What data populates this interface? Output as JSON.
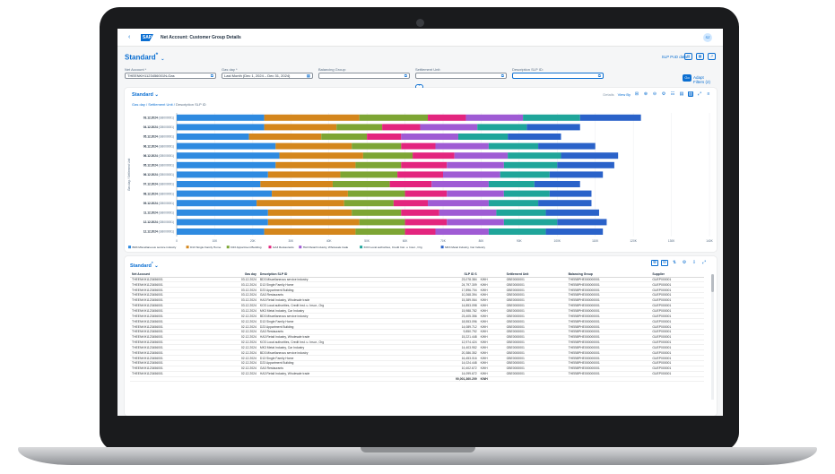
{
  "app": {
    "back_glyph": "‹",
    "logo_text": "SAP",
    "title": "Net Account: Customer Group Details",
    "avatar": "SZ"
  },
  "variant": {
    "label": "Standard",
    "marker": "*"
  },
  "header_actions": {
    "slp_button": "SLP PoD data"
  },
  "filters": [
    {
      "label": "Net Account *",
      "value": "THEENKH1123456001N-Gas"
    },
    {
      "label": "Gas day *",
      "value": "Last Month (Dec 1, 2024 – Dec 31, 2024)"
    },
    {
      "label": "Balancing Group:",
      "value": ""
    },
    {
      "label": "Settlement Unit:",
      "value": ""
    },
    {
      "label": "Description SLP ID:",
      "value": ""
    }
  ],
  "filter_actions": {
    "go": "Go",
    "adapt": "Adapt Filters (2)"
  },
  "chart_card": {
    "title": "Standard",
    "breadcrumb": [
      "Gas day",
      "Settlement Unit",
      "Description SLP ID"
    ],
    "view_label": "Details",
    "view_by": "View By"
  },
  "chart_data": {
    "type": "bar",
    "orientation": "horizontal",
    "stacked": true,
    "ylabel": "Gas day / Settlement Unit",
    "categories": [
      "03.12.2024 (GB000001)",
      "04.12.2024 (GB000001)",
      "05.12.2024 (GB000001)",
      "06.12.2024 (GB000001)",
      "06.12.2024 (GB000001)",
      "05.12.2024 (GB000001)",
      "06.12.2024 (GB000001)",
      "07.12.2024 (GB000001)",
      "08.12.2024 (GB000001)",
      "09.12.2024 (GB000001)",
      "11.12.2024 (GB000001)",
      "12.12.2024 (GB000001)",
      "12.12.2024 (GB000001)"
    ],
    "x_ticks": [
      "0",
      "10K",
      "20K",
      "30K",
      "40K",
      "50K",
      "60K",
      "70K",
      "80K",
      "90K",
      "100K",
      "110K",
      "120K",
      "130K",
      "140K"
    ],
    "xlim": [
      0,
      140000
    ],
    "series": [
      {
        "name": "BD3 Miscellaneous service industry",
        "color": "#2e8ae0",
        "values": [
          23000,
          23000,
          19000,
          26000,
          27000,
          26000,
          24000,
          22000,
          25000,
          21000,
          24000,
          24000,
          23000
        ]
      },
      {
        "name": "D13 Single Family Home",
        "color": "#d4861c",
        "values": [
          25000,
          19000,
          19000,
          20000,
          22000,
          21000,
          19000,
          19000,
          20000,
          23000,
          22000,
          24000,
          24000
        ]
      },
      {
        "name": "D23 Appartment Building",
        "color": "#7da534",
        "values": [
          18000,
          12000,
          12000,
          13000,
          13000,
          12000,
          15000,
          15000,
          15000,
          13000,
          13000,
          12000,
          13000
        ]
      },
      {
        "name": "GA3 Restaurants",
        "color": "#e3257e",
        "values": [
          10000,
          10000,
          9000,
          9000,
          11000,
          12000,
          12000,
          11000,
          11000,
          9000,
          10000,
          11000,
          8000
        ]
      },
      {
        "name": "HA3 Retail Industry, Wholesale trade",
        "color": "#9f5bd4",
        "values": [
          15000,
          15000,
          15000,
          14000,
          14000,
          15000,
          15000,
          15000,
          15000,
          16000,
          15000,
          15000,
          14000
        ]
      },
      {
        "name": "KO3 Local authorities, Credit Inst. u. Insur., Org",
        "color": "#1fa59a",
        "values": [
          15000,
          13000,
          13000,
          13000,
          14000,
          14000,
          13000,
          12000,
          12000,
          13000,
          13000,
          14000,
          15000
        ]
      },
      {
        "name": "MK3 Metal Industry, Car Industry",
        "color": "#2a62c9",
        "values": [
          16000,
          14000,
          14000,
          15000,
          15000,
          15000,
          14000,
          12000,
          11000,
          14000,
          14000,
          13000,
          15000
        ]
      }
    ]
  },
  "table_card": {
    "title": "Standard",
    "marker": "*",
    "columns": [
      "Net Account",
      "Gas day",
      "Description SLP ID",
      "SLP ID S",
      "",
      "Settlement Unit",
      "Balancing Group",
      "Supplier"
    ],
    "rows": [
      [
        "THEENKH1123456001",
        "03.12.2024",
        "BD3 Miscellaneous service industry",
        "23,078.384",
        "KWH",
        "GBE0000001",
        "THEBBPHE000000001",
        "GUEP000001"
      ],
      [
        "THEENKH1123456001",
        "03.12.2024",
        "D13 Single Family Home",
        "24,797.309",
        "KWH",
        "GBE0000001",
        "THEBBPHE000000001",
        "GUEP000001"
      ],
      [
        "THEENKH1123456001",
        "03.12.2024",
        "D23 Appartment Building",
        "17,896.704",
        "KWH",
        "GBE0000001",
        "THEBBPHE000000001",
        "GUEP000001"
      ],
      [
        "THEENKH1123456001",
        "03.12.2024",
        "GA3 Restaurants",
        "10,268.394",
        "KWH",
        "GBE0000001",
        "THEBBPHE000000001",
        "GUEP000001"
      ],
      [
        "THEENKH1123456001",
        "03.12.2024",
        "HA3 Retail Industry, Wholesale trade",
        "15,389.064",
        "KWH",
        "GBE0000001",
        "THEBBPHE000000001",
        "GUEP000001"
      ],
      [
        "THEENKH1123456001",
        "03.12.2024",
        "KO3 Local authorities, Credit Inst. u. Insur., Org",
        "14,853.098",
        "KWH",
        "GBE0000001",
        "THEBBPHE000000001",
        "GUEP000001"
      ],
      [
        "THEENKH1123456001",
        "03.12.2024",
        "MK3 Metal Industry, Car Industry",
        "15,988.782",
        "KWH",
        "GBE0000001",
        "THEBBPHE000000001",
        "GUEP000001"
      ],
      [
        "THEENKH1123456001",
        "02.12.2024",
        "BD3 Miscellaneous service industry",
        "23,405.356",
        "KWH",
        "GBE0000001",
        "THEBBPHE000000001",
        "GUEP000001"
      ],
      [
        "THEENKH1123456001",
        "02.12.2024",
        "D13 Single Family Home",
        "18,553.096",
        "KWH",
        "GBE0000001",
        "THEBBPHE000000001",
        "GUEP000001"
      ],
      [
        "THEENKH1123456001",
        "02.12.2024",
        "D23 Appartment Building",
        "14,089.712",
        "KWH",
        "GBE0000001",
        "THEBBPHE000000001",
        "GUEP000001"
      ],
      [
        "THEENKH1123456001",
        "02.12.2024",
        "GA3 Restaurants",
        "9,850.792",
        "KWH",
        "GBE0000001",
        "THEBBPHE000000001",
        "GUEP000001"
      ],
      [
        "THEENKH1123456001",
        "02.12.2024",
        "HA3 Retail Industry, Wholesale trade",
        "15,221.448",
        "KWH",
        "GBE0000001",
        "THEBBPHE000000001",
        "GUEP000001"
      ],
      [
        "THEENKH1123456001",
        "02.12.2024",
        "KO3 Local authorities, Credit Inst. u. Insur., Org",
        "12,974.424",
        "KWH",
        "GBE0000001",
        "THEBBPHE000000001",
        "GUEP000001"
      ],
      [
        "THEENKH1123456001",
        "02.12.2024",
        "MK3 Metal Industry, Car Industry",
        "14,403.952",
        "KWH",
        "GBE0000001",
        "THEBBPHE000000001",
        "GUEP000001"
      ],
      [
        "THEENKH1123456001",
        "02.12.2024",
        "BD3 Miscellaneous service industry",
        "20,386.352",
        "KWH",
        "GBE0000001",
        "THEBBPHE000000001",
        "GUEP000001"
      ],
      [
        "THEENKH1123456001",
        "02.12.2024",
        "D13 Single Family Home",
        "16,453.016",
        "KWH",
        "GBE0000001",
        "THEBBPHE000000001",
        "GUEP000001"
      ],
      [
        "THEENKH1123456001",
        "02.12.2024",
        "D23 Appartment Building",
        "14,024.448",
        "KWH",
        "GBE0000001",
        "THEBBPHE000000001",
        "GUEP000001"
      ],
      [
        "THEENKH1123456001",
        "02.12.2024",
        "GA3 Restaurants",
        "10,402.672",
        "KWH",
        "GBE0000001",
        "THEBBPHE000000001",
        "GUEP000001"
      ],
      [
        "THEENKH1123456001",
        "02.12.2024",
        "HA3 Retail Industry, Wholesale trade",
        "14,099.672",
        "KWH",
        "GBE0000001",
        "THEBBPHE000000001",
        "GUEP000001"
      ]
    ],
    "total": {
      "value": "90,001,360.209",
      "unit": "KWH"
    }
  },
  "colors": {
    "accent": "#0a6ed1",
    "frame": "#1a1b1d"
  }
}
